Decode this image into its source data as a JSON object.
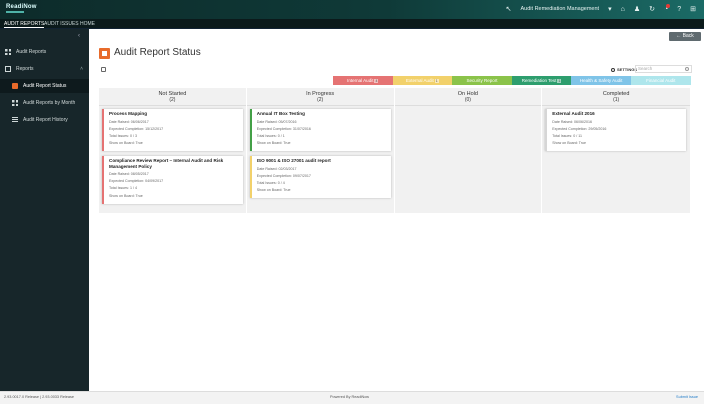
{
  "app": {
    "logo": "ReadiNow"
  },
  "topbar": {
    "title": "Audit Remediation Management"
  },
  "nav": {
    "tabs": [
      "AUDIT REPORTS",
      "AUDIT ISSUES",
      "HOME"
    ]
  },
  "sidebar": {
    "items": [
      {
        "label": "Audit Reports"
      },
      {
        "label": "Reports"
      },
      {
        "label": "Audit Report Status"
      },
      {
        "label": "Audit Reports by Month"
      },
      {
        "label": "Audit Report History"
      }
    ]
  },
  "page": {
    "title": "Audit Report Status",
    "back_label": "Back",
    "settings_label": "SETTINGS",
    "search_placeholder": "Search"
  },
  "legend": [
    {
      "label": "Internal Audit",
      "count": "4",
      "color": "#e57373"
    },
    {
      "label": "External Audit",
      "count": "1",
      "color": "#f2d16b"
    },
    {
      "label": "Security Report",
      "count": "",
      "color": "#8bc34a"
    },
    {
      "label": "Remediation Test",
      "count": "1",
      "color": "#2e9e6e"
    },
    {
      "label": "Health & Safety Audit",
      "count": "",
      "color": "#7fc4e8"
    },
    {
      "label": "Financial Audit",
      "count": "",
      "color": "#aee6ec"
    }
  ],
  "columns": [
    {
      "name": "Not Started",
      "count": "(2)",
      "cards": [
        {
          "title": "Process Mapping",
          "lines": [
            "Date Raised: 06/06/2017",
            "Expected Completion: 15/12/2017",
            "Total Issues: 0 / 3",
            "Show on Board: True"
          ]
        },
        {
          "title": "Compliance Review Report – Internal Audit and Risk Management Policy",
          "lines": [
            "Date Raised: 08/05/2017",
            "Expected Completion: 04/09/2017",
            "Total Issues: 1 / 4",
            "Show on Board: True"
          ]
        }
      ]
    },
    {
      "name": "In Progress",
      "count": "(2)",
      "cards": [
        {
          "title": "Annual IT Box Testing",
          "lines": [
            "Date Raised: 05/07/2016",
            "Expected Completion: 31/07/2016",
            "Total Issues: 0 / 1",
            "Show on Board: True"
          ]
        },
        {
          "title": "ISO 9001 & ISO 27001 audit report",
          "lines": [
            "Date Raised: 02/03/2017",
            "Expected Completion: 09/07/2017",
            "Total Issues: 0 / 4",
            "Show on Board: True"
          ]
        }
      ]
    },
    {
      "name": "On Hold",
      "count": "(0)",
      "cards": []
    },
    {
      "name": "Completed",
      "count": "(1)",
      "cards": [
        {
          "title": "External Audit 2016",
          "lines": [
            "Date Raised: 06/06/2016",
            "Expected Completion: 29/05/2016",
            "Total Issues: 0 / 11",
            "Show on Board: True"
          ]
        }
      ]
    }
  ],
  "footer": {
    "left": "2.93.0017.0 Release  |  2.93.0033 Release",
    "center": "Powered By ReadiNow",
    "right": "Submit Issue"
  }
}
